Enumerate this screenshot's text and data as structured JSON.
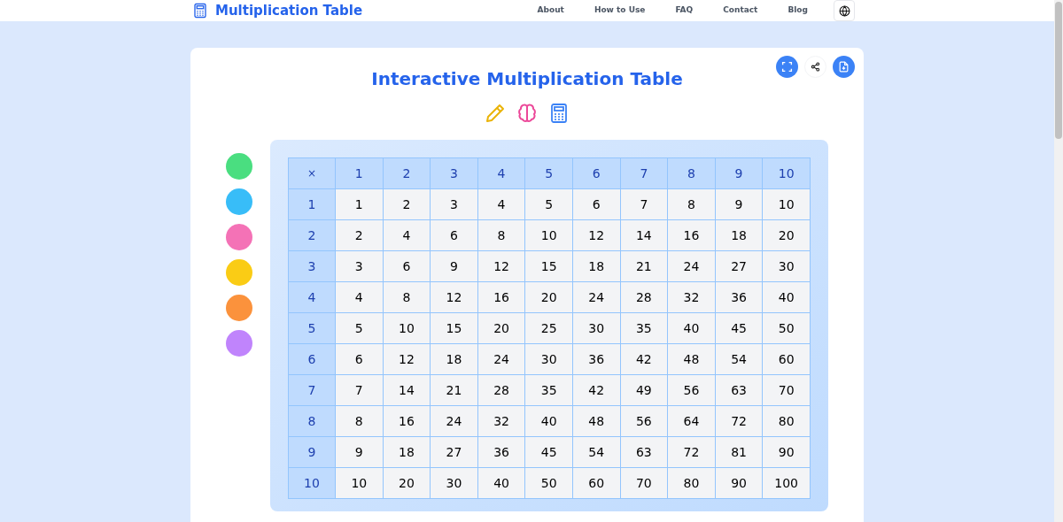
{
  "header": {
    "logo_text": "Multiplication Table",
    "nav": [
      "About",
      "How to Use",
      "FAQ",
      "Contact",
      "Blog"
    ]
  },
  "card": {
    "title": "Interactive Multiplication Table",
    "color_swatches": [
      {
        "color": "#4ade80"
      },
      {
        "color": "#38bdf8"
      },
      {
        "color": "#f472b6"
      },
      {
        "color": "#facc15"
      },
      {
        "color": "#fb923c"
      },
      {
        "color": "#c084fc"
      }
    ],
    "table": {
      "corner": "×",
      "columns": [
        "1",
        "2",
        "3",
        "4",
        "5",
        "6",
        "7",
        "8",
        "9",
        "10"
      ],
      "rows": [
        {
          "header": "1",
          "cells": [
            "1",
            "2",
            "3",
            "4",
            "5",
            "6",
            "7",
            "8",
            "9",
            "10"
          ]
        },
        {
          "header": "2",
          "cells": [
            "2",
            "4",
            "6",
            "8",
            "10",
            "12",
            "14",
            "16",
            "18",
            "20"
          ]
        },
        {
          "header": "3",
          "cells": [
            "3",
            "6",
            "9",
            "12",
            "15",
            "18",
            "21",
            "24",
            "27",
            "30"
          ]
        },
        {
          "header": "4",
          "cells": [
            "4",
            "8",
            "12",
            "16",
            "20",
            "24",
            "28",
            "32",
            "36",
            "40"
          ]
        },
        {
          "header": "5",
          "cells": [
            "5",
            "10",
            "15",
            "20",
            "25",
            "30",
            "35",
            "40",
            "45",
            "50"
          ]
        },
        {
          "header": "6",
          "cells": [
            "6",
            "12",
            "18",
            "24",
            "30",
            "36",
            "42",
            "48",
            "54",
            "60"
          ]
        },
        {
          "header": "7",
          "cells": [
            "7",
            "14",
            "21",
            "28",
            "35",
            "42",
            "49",
            "56",
            "63",
            "70"
          ]
        },
        {
          "header": "8",
          "cells": [
            "8",
            "16",
            "24",
            "32",
            "40",
            "48",
            "56",
            "64",
            "72",
            "80"
          ]
        },
        {
          "header": "9",
          "cells": [
            "9",
            "18",
            "27",
            "36",
            "45",
            "54",
            "63",
            "72",
            "81",
            "90"
          ]
        },
        {
          "header": "10",
          "cells": [
            "10",
            "20",
            "30",
            "40",
            "50",
            "60",
            "70",
            "80",
            "90",
            "100"
          ]
        }
      ]
    }
  }
}
